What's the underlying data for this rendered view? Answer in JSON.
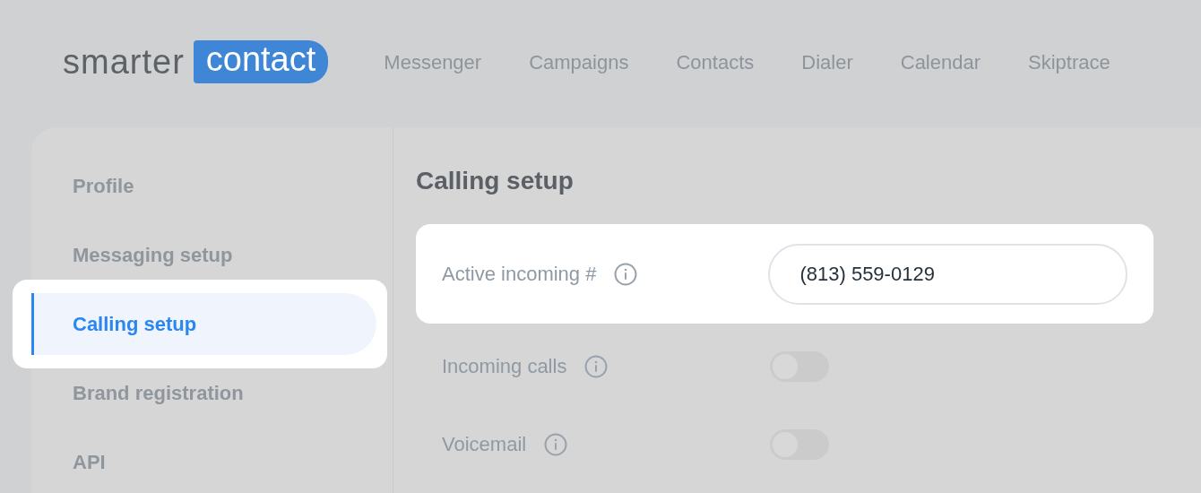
{
  "logo": {
    "word": "smarter",
    "badge": "contact"
  },
  "nav": [
    "Messenger",
    "Campaigns",
    "Contacts",
    "Dialer",
    "Calendar",
    "Skiptrace"
  ],
  "sidebar": {
    "items": [
      {
        "label": "Profile",
        "selected": false
      },
      {
        "label": "Messaging setup",
        "selected": false
      },
      {
        "label": "Calling setup",
        "selected": true
      },
      {
        "label": "Brand registration",
        "selected": false
      },
      {
        "label": "API",
        "selected": false
      }
    ]
  },
  "content": {
    "title": "Calling setup",
    "rows": [
      {
        "kind": "input",
        "label": "Active incoming #",
        "value": "(813) 559-0129",
        "highlighted": true
      },
      {
        "kind": "toggle",
        "label": "Incoming calls",
        "on": false,
        "highlighted": false
      },
      {
        "kind": "toggle",
        "label": "Voicemail",
        "on": false,
        "highlighted": false
      }
    ]
  }
}
